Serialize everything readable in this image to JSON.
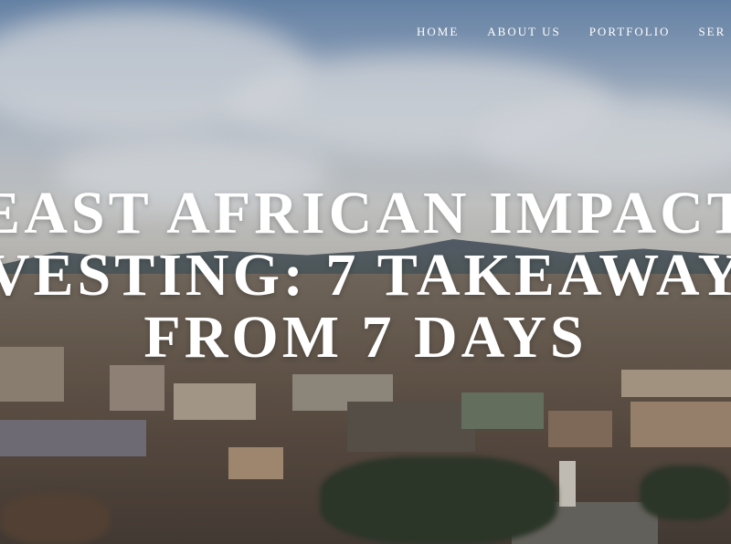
{
  "nav": {
    "items": [
      {
        "label": "HOME"
      },
      {
        "label": "ABOUT US"
      },
      {
        "label": "PORTFOLIO"
      },
      {
        "label": "SER"
      }
    ]
  },
  "hero": {
    "title_lines": [
      "EAST AFRICAN IMPACT",
      "VESTING: 7 TAKEAWAY",
      "FROM 7 DAYS"
    ],
    "background": "city-skyline-photo",
    "text_color": "#ffffff"
  }
}
